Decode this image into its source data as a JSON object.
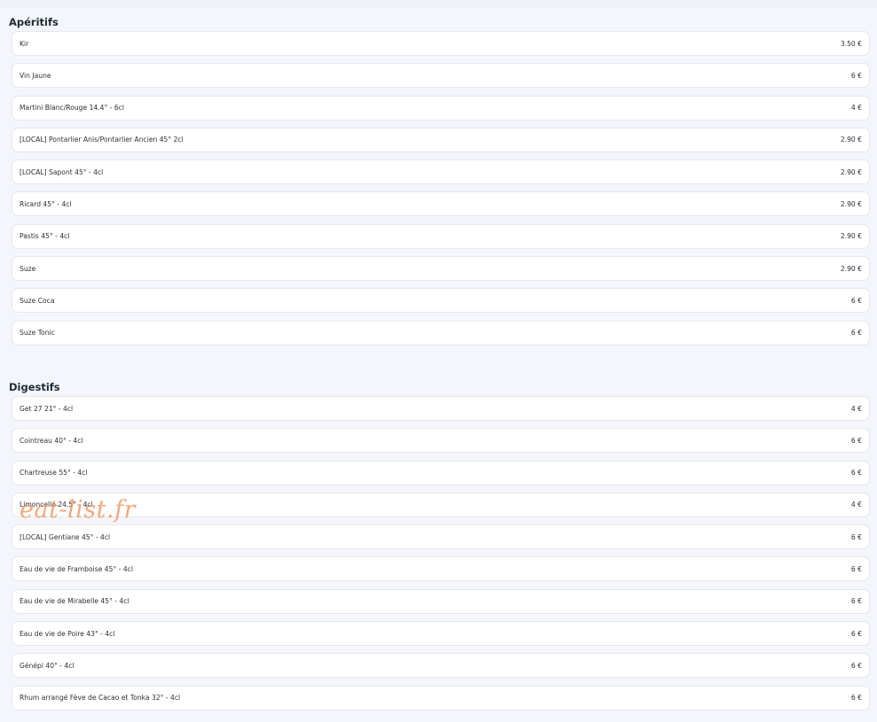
{
  "sections": [
    {
      "title": "Apéritifs",
      "items": [
        {
          "name": "Kir",
          "price": "3.50 €"
        },
        {
          "name": "Vin Jaune",
          "price": "6 €"
        },
        {
          "name": "Martini Blanc/Rouge 14.4° - 6cl",
          "price": "4 €"
        },
        {
          "name": "[LOCAL] Pontarlier Anis/Pontarlier Ancien 45° 2cl",
          "price": "2.90 €"
        },
        {
          "name": "[LOCAL] Sapont 45° - 4cl",
          "price": "2.90 €"
        },
        {
          "name": "Ricard 45° - 4cl",
          "price": "2.90 €"
        },
        {
          "name": "Pastis 45° - 4cl",
          "price": "2.90 €"
        },
        {
          "name": "Suze",
          "price": "2.90 €"
        },
        {
          "name": "Suze Coca",
          "price": "6 €"
        },
        {
          "name": "Suze Tonic",
          "price": "6 €"
        }
      ]
    },
    {
      "title": "Digestifs",
      "items": [
        {
          "name": "Get 27 21° - 4cl",
          "price": "4 €"
        },
        {
          "name": "Cointreau 40° - 4cl",
          "price": "6 €"
        },
        {
          "name": "Chartreuse 55° - 4cl",
          "price": "6 €"
        },
        {
          "name": "Limoncello 24.5° - 4cl",
          "price": "4 €"
        },
        {
          "name": "[LOCAL] Gentiane 45° - 4cl",
          "price": "6 €"
        },
        {
          "name": "Eau de vie de Framboise 45° - 4cl",
          "price": "6 €"
        },
        {
          "name": "Eau de vie de Mirabelle 45° - 4cl",
          "price": "6 €"
        },
        {
          "name": "Eau de vie de Poire 43° - 4cl",
          "price": "6 €"
        },
        {
          "name": "Génépi 40° - 4cl",
          "price": "6 €"
        },
        {
          "name": "Rhum arrangé Fève de Cacao et Tonka 32° - 4cl",
          "price": "6 €"
        }
      ]
    }
  ],
  "watermark": "eat-list.fr"
}
